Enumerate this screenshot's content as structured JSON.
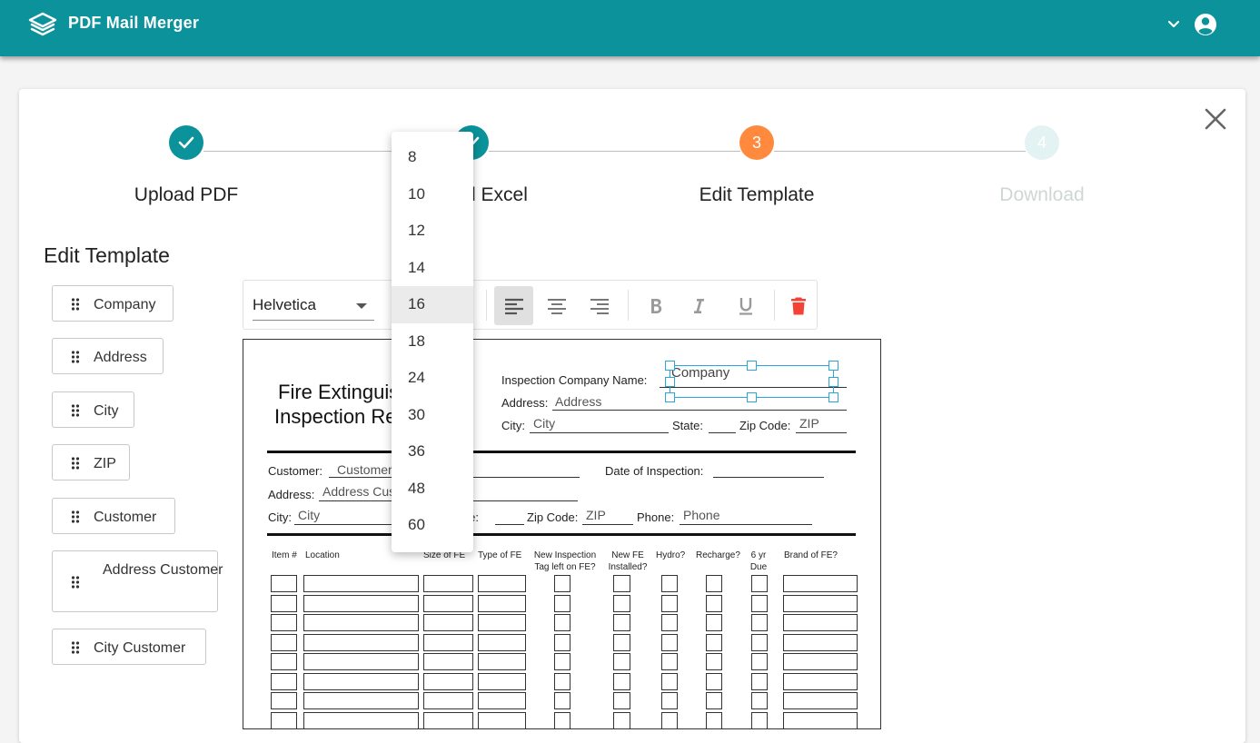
{
  "app": {
    "title": "PDF Mail Merger"
  },
  "stepper": {
    "steps": [
      {
        "num": "1",
        "label": "Upload PDF",
        "state": "done"
      },
      {
        "num": "2",
        "label": "Upload Excel",
        "state": "done"
      },
      {
        "num": "3",
        "label": "Edit Template",
        "state": "active"
      },
      {
        "num": "4",
        "label": "Download",
        "state": "disabled"
      }
    ]
  },
  "sidebar": {
    "title": "Edit Template",
    "fields": [
      "Company",
      "Address",
      "City",
      "ZIP",
      "Customer",
      "Address Customer",
      "City Customer"
    ]
  },
  "toolbar": {
    "font_family": "Helvetica",
    "font_size": "16",
    "alignment": "left"
  },
  "font_size_menu": {
    "options": [
      "8",
      "10",
      "12",
      "14",
      "16",
      "18",
      "24",
      "30",
      "36",
      "48",
      "60"
    ],
    "selected": "16"
  },
  "document": {
    "title_line1": "Fire Extinguisher",
    "title_line2": "Inspection Report",
    "inspection_company_label": "Inspection Company Name:",
    "address_label": "Address:",
    "city_label": "City:",
    "state_label": "State:",
    "zip_label": "Zip Code:",
    "customer_label": "Customer:",
    "date_label": "Date of Inspection:",
    "phone_label": "Phone:",
    "placed": {
      "company": "Company",
      "address": "Address",
      "city": "City",
      "zip": "ZIP",
      "customer": "Customer",
      "address_customer": "Address Customer",
      "city_customer": "City",
      "zip_customer": "ZIP",
      "phone": "Phone"
    },
    "columns": [
      "Item #",
      "Location",
      "Size of FE",
      "Type of FE",
      "New Inspection Tag left on FE?",
      "New FE Installed?",
      "Hydro?",
      "Recharge?",
      "6 yr Due",
      "Brand of FE?"
    ]
  },
  "colors": {
    "primary": "#0b929a",
    "step_active": "#ff8a3d",
    "step_disabled": "#e3f3f3",
    "delete": "#f44336",
    "selection": "#2aa7d9"
  }
}
